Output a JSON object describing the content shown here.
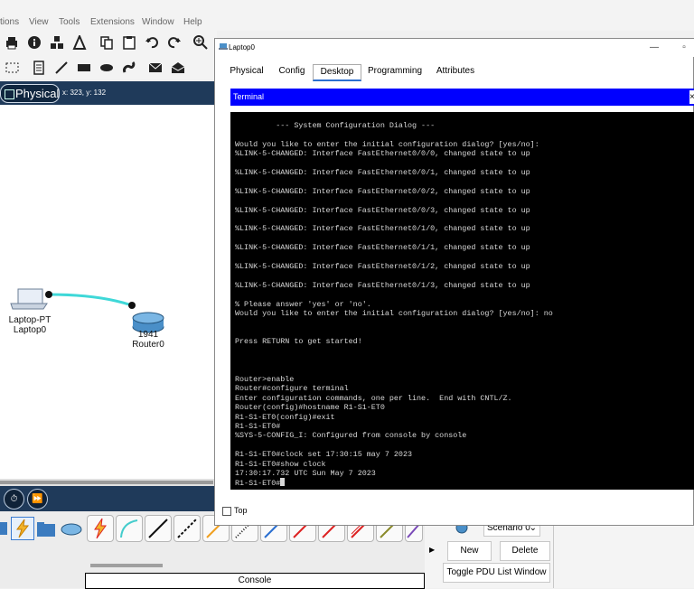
{
  "menu": {
    "items": [
      "tions",
      "View",
      "Tools",
      "Extensions",
      "Window",
      "Help"
    ]
  },
  "toolbar1": {
    "icons": [
      "print-icon",
      "info-icon",
      "network-info-icon",
      "font-icon",
      "copy-icon",
      "paste-icon",
      "undo-icon",
      "redo-icon",
      "zoom-in-icon"
    ]
  },
  "toolbar2": {
    "icons": [
      "select-area-icon",
      "note-icon",
      "line-icon",
      "rectangle-icon",
      "ellipse-icon",
      "freeform-icon",
      "mail-icon",
      "open-mail-icon"
    ]
  },
  "workspace_bar": {
    "mode_label": "Physical",
    "coords": "x: 323, y: 132"
  },
  "devices": {
    "laptop": {
      "type": "Laptop-PT",
      "name": "Laptop0"
    },
    "router": {
      "model": "1941",
      "name": "Router0"
    }
  },
  "laptop_window": {
    "title": "Laptop0",
    "tabs": [
      "Physical",
      "Config",
      "Desktop",
      "Programming",
      "Attributes"
    ],
    "active_tab": "Desktop",
    "terminal_label": "Terminal",
    "terminal_lines": [
      "         --- System Configuration Dialog ---",
      "",
      "Would you like to enter the initial configuration dialog? [yes/no]:",
      "%LINK-5-CHANGED: Interface FastEthernet0/0/0, changed state to up",
      "",
      "%LINK-5-CHANGED: Interface FastEthernet0/0/1, changed state to up",
      "",
      "%LINK-5-CHANGED: Interface FastEthernet0/0/2, changed state to up",
      "",
      "%LINK-5-CHANGED: Interface FastEthernet0/0/3, changed state to up",
      "",
      "%LINK-5-CHANGED: Interface FastEthernet0/1/0, changed state to up",
      "",
      "%LINK-5-CHANGED: Interface FastEthernet0/1/1, changed state to up",
      "",
      "%LINK-5-CHANGED: Interface FastEthernet0/1/2, changed state to up",
      "",
      "%LINK-5-CHANGED: Interface FastEthernet0/1/3, changed state to up",
      "",
      "% Please answer 'yes' or 'no'.",
      "Would you like to enter the initial configuration dialog? [yes/no]: no",
      "",
      "",
      "Press RETURN to get started!",
      "",
      "",
      "",
      "Router>enable",
      "Router#configure terminal",
      "Enter configuration commands, one per line.  End with CNTL/Z.",
      "Router(config)#hostname R1-S1-ET0",
      "R1-S1-ET0(config)#exit",
      "R1-S1-ET0#",
      "%SYS-5-CONFIG_I: Configured from console by console",
      "",
      "R1-S1-ET0#clock set 17:30:15 may 7 2023",
      "R1-S1-ET0#show clock",
      "17:30:17.732 UTC Sun May 7 2023",
      "R1-S1-ET0#"
    ],
    "top_checkbox_label": "Top"
  },
  "pdu_panel": {
    "scenario": "Scenario 0",
    "new_label": "New",
    "delete_label": "Delete",
    "toggle_label": "Toggle PDU List Window"
  },
  "palette": {
    "console_label": "Console"
  },
  "colors": {
    "nav_bar": "#1f3a5a",
    "terminal_header": "#0000ff",
    "cable": "#3fd8d8"
  }
}
